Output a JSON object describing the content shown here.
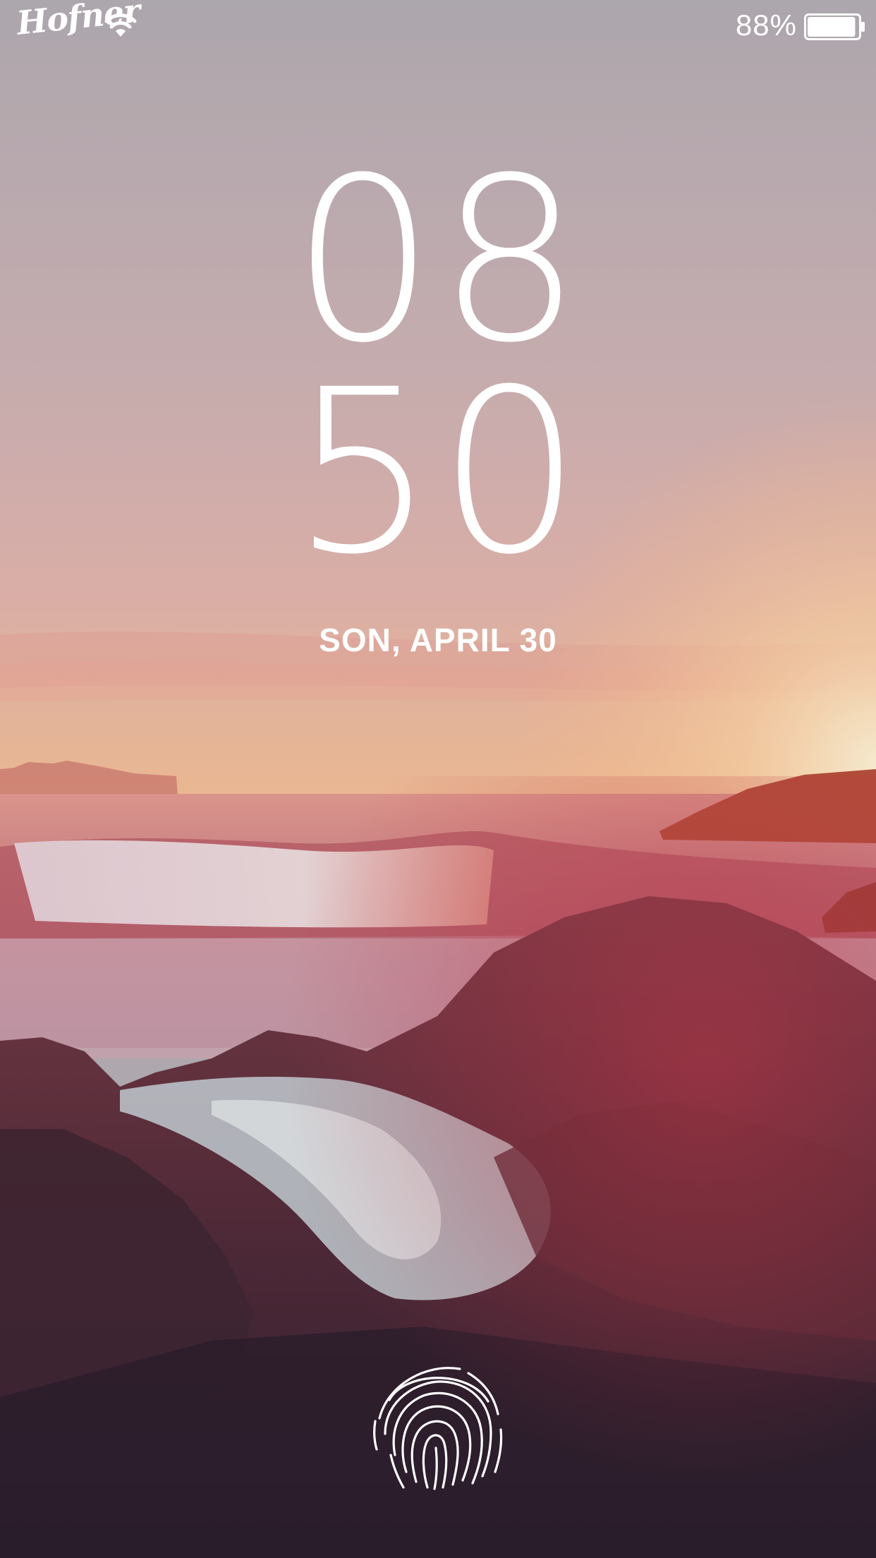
{
  "status_bar": {
    "carrier": "Hofner",
    "battery_percent": "88%",
    "battery_level": 0.95,
    "wifi_icon": "wifi-icon",
    "battery_icon": "battery-icon"
  },
  "lock_screen": {
    "hours": "08",
    "minutes": "50",
    "date": "SON, APRIL 30",
    "unlock_icon": "fingerprint-icon"
  },
  "colors": {
    "sky_top": "#b6aeb6",
    "sky_mid": "#d8b5b5",
    "horizon": "#f2b98f",
    "sun": "#ffdca0",
    "sea": "#d98a8e",
    "rock_dark": "#3a2630",
    "rock_mid": "#6b3a45",
    "foam": "#e8e4ea",
    "text": "#ffffff"
  }
}
